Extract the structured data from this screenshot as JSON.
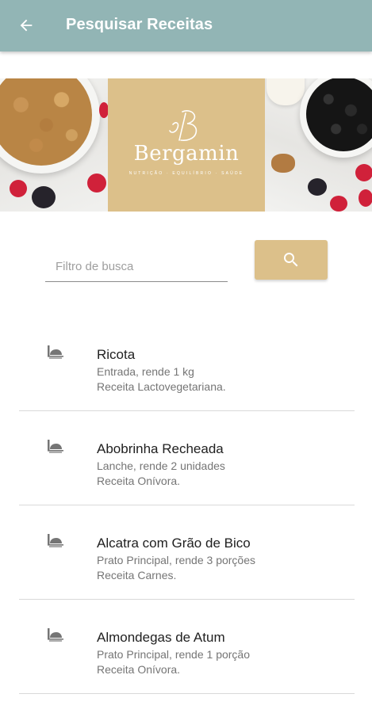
{
  "appbar": {
    "title": "Pesquisar Receitas",
    "back_icon": "arrow-left-icon",
    "background": "#92b5b5"
  },
  "banner": {
    "logo_name": "Bergamin",
    "logo_tagline": "NUTRIÇÃO · EQUILÍBRIO · SAÚDE",
    "logo_color": "#dcc08a"
  },
  "search": {
    "placeholder": "Filtro de busca",
    "value": "",
    "button_icon": "search-icon",
    "button_color": "#dcc08a"
  },
  "recipes": [
    {
      "title": "Ricota",
      "subtitle": "Entrada, rende 1 kg",
      "type": "Receita Lactovegetariana.",
      "icon": "recipe-plate-icon"
    },
    {
      "title": "Abobrinha Recheada",
      "subtitle": "Lanche, rende 2 unidades",
      "type": "Receita Onívora.",
      "icon": "recipe-plate-icon"
    },
    {
      "title": "Alcatra com Grão de Bico",
      "subtitle": "Prato Principal, rende 3 porções",
      "type": "Receita Carnes.",
      "icon": "recipe-plate-icon"
    },
    {
      "title": "Almondegas de Atum",
      "subtitle": "Prato Principal, rende 1 porção",
      "type": "Receita Onívora.",
      "icon": "recipe-plate-icon"
    }
  ]
}
